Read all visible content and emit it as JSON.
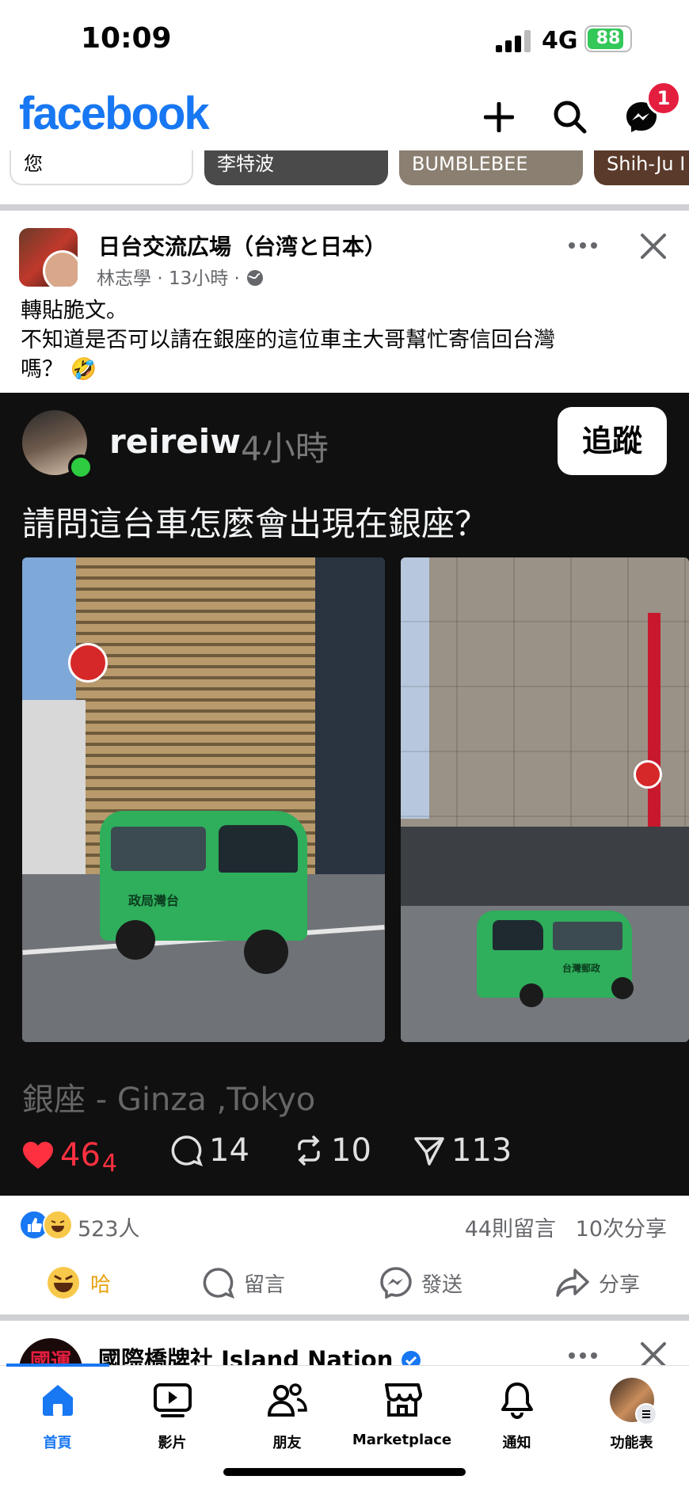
{
  "status_bar": {
    "time": "10:09",
    "network": "4G",
    "battery": "88",
    "battery_level": 0.88
  },
  "header": {
    "logo": "facebook",
    "messenger_badge": "1"
  },
  "stories": [
    "您",
    "李特波",
    "BUMBLEBEE",
    "Shih-Ju I"
  ],
  "post": {
    "group_name": "日台交流広場（台湾と日本）",
    "author": "林志學",
    "time": "13小時",
    "text_line1": "轉貼脆文。",
    "text_line2": "不知道是否可以請在銀座的這位車主大哥幫忙寄信回台灣",
    "text_line3": "嗎？ 🤣"
  },
  "threads_embed": {
    "username": "reireiw",
    "time": "4小時",
    "follow_label": "追蹤",
    "question": "請問這台車怎麼會出現在銀座？",
    "location": "銀座 - Ginza ,Tokyo",
    "likes": "46",
    "likes_sub": "4",
    "comments": "14",
    "reposts": "10",
    "shares": "113",
    "van_text_left": "政局灣台",
    "van_text_right": "台灣郵政"
  },
  "reactions": {
    "count": "523人",
    "comments": "44則留言",
    "shares": "10次分享"
  },
  "actions": {
    "haha": "哈",
    "comment": "留言",
    "send": "發送",
    "share": "分享"
  },
  "next_post": {
    "avatar_text": "國運",
    "name": "國際橋牌社 Island Nation"
  },
  "tabs": [
    "首頁",
    "影片",
    "朋友",
    "Marketplace",
    "通知",
    "功能表"
  ],
  "colors": {
    "facebook_blue": "#1877f2",
    "like_red": "#ff3040",
    "badge_red": "#e41e3f"
  }
}
